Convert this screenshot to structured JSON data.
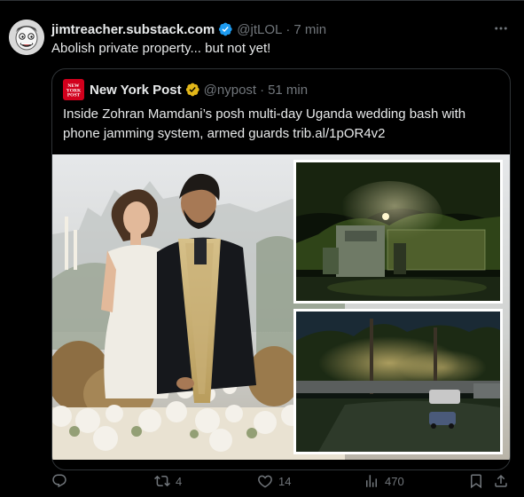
{
  "tweet": {
    "author_name": "jimtreacher.substack.com",
    "author_handle": "@jtLOL",
    "separator": "·",
    "time": "7 min",
    "text": "Abolish private property... but not yet!"
  },
  "quote": {
    "author_name": "New York Post",
    "author_handle": "@nypost",
    "separator": "·",
    "time": "51 min",
    "text": "Inside Zohran Mamdani’s posh multi-day Uganda wedding bash with phone jamming system, armed guards trib.al/1pOR4v2",
    "media": {
      "images": [
        "wedding-couple-photo",
        "night-compound-gate-photo",
        "night-compound-driveway-photo"
      ]
    }
  },
  "actions": {
    "reply_count": "",
    "repost_count": "4",
    "like_count": "14",
    "views_count": "470"
  },
  "icons": {
    "verified": "verified-badge-icon",
    "gold_verified": "gold-verified-badge-icon",
    "more": "more-options-icon",
    "reply": "reply-icon",
    "repost": "repost-icon",
    "like": "heart-icon",
    "views": "views-icon",
    "bookmark": "bookmark-icon",
    "share": "share-icon"
  },
  "colors": {
    "background": "#000000",
    "text": "#e7e9ea",
    "muted": "#71767b",
    "border": "#2f3336",
    "verified_blue": "#1d9bf0",
    "verified_gold": "#e2b719",
    "nypost_red": "#d1001c"
  }
}
